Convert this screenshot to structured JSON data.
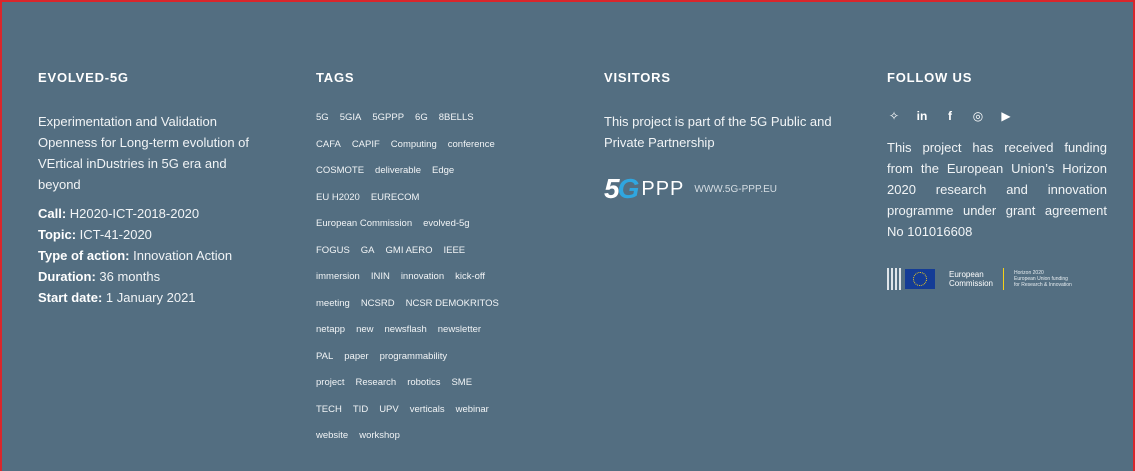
{
  "col1": {
    "heading": "EVOLVED-5G",
    "description": "Experimentation and Validation Openness for Long-term evolution of VErtical inDustries in 5G era and beyond",
    "meta": [
      {
        "label": "Call:",
        "value": " H2020-ICT-2018-2020"
      },
      {
        "label": "Topic:",
        "value": " ICT-41-2020"
      },
      {
        "label": "Type of action:",
        "value": " Innovation Action"
      },
      {
        "label": "Duration:",
        "value": " 36 months"
      },
      {
        "label": "Start date:",
        "value": " 1 January 2021"
      }
    ]
  },
  "tags": {
    "heading": "TAGS",
    "rows": [
      [
        "5G",
        "5GIA",
        "5GPPP",
        "6G",
        "8BELLS"
      ],
      [
        "CAFA",
        "CAPIF",
        "Computing",
        "conference"
      ],
      [
        "COSMOTE",
        "deliverable",
        "Edge"
      ],
      [
        "EU H2020",
        "EURECOM"
      ],
      [
        "European Commission",
        "evolved-5g"
      ],
      [
        "FOGUS",
        "GA",
        "GMI AERO",
        "IEEE"
      ],
      [
        "immersion",
        "ININ",
        "innovation",
        "kick-off"
      ],
      [
        "meeting",
        "NCSRD",
        "NCSR DEMOKRITOS"
      ],
      [
        "netapp",
        "new",
        "newsflash",
        "newsletter"
      ],
      [
        "PAL",
        "paper",
        "programmability"
      ],
      [
        "project",
        "Research",
        "robotics",
        "SME"
      ],
      [
        "TECH",
        "TID",
        "UPV",
        "verticals",
        "webinar"
      ],
      [
        "website",
        "workshop"
      ]
    ]
  },
  "visitors": {
    "heading": "VISITORS",
    "text": "This project is part of the 5G Public and Private Partnership",
    "logo_5": "5",
    "logo_g": "G",
    "logo_ppp": "PPP",
    "logo_url": "WWW.5G-PPP.EU"
  },
  "follow": {
    "heading": "FOLLOW US",
    "icons": [
      {
        "name": "twitter-icon",
        "glyph": "✧"
      },
      {
        "name": "linkedin-icon",
        "glyph": "in"
      },
      {
        "name": "facebook-icon",
        "glyph": "f"
      },
      {
        "name": "instagram-icon",
        "glyph": "◎"
      },
      {
        "name": "youtube-icon",
        "glyph": "▶"
      }
    ],
    "funding": "This project has received funding from the European Union’s Horizon 2020 research and innovation programme under grant agreement No 101016608",
    "eu_name_1": "European",
    "eu_name_2": "Commission",
    "eu_h2020_1": "Horizon 2020",
    "eu_h2020_2": "European Union funding",
    "eu_h2020_3": "for Research & Innovation"
  },
  "colors": {
    "background": "#536e81",
    "frame_border": "#d9262c",
    "accent": "#2fa6e0"
  }
}
